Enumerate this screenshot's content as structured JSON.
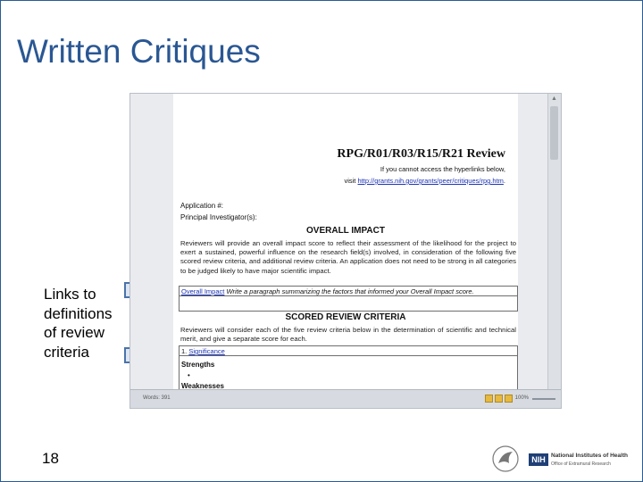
{
  "slide": {
    "title": "Written Critiques",
    "side_text_lines": [
      "Links to",
      "definitions",
      "of review",
      "criteria"
    ],
    "page_number": "18"
  },
  "document": {
    "title": "RPG/R01/R03/R15/R21 Review",
    "hyperlink_note": "If you cannot access the hyperlinks below,",
    "visit_prefix": "visit",
    "url": "http://grants.nih.gov/grants/peer/critiques/rpg.htm",
    "url_suffix": ".",
    "application_label": "Application #:",
    "pi_label": "Principal Investigator(s):",
    "overall_impact_heading": "OVERALL IMPACT",
    "overall_impact_para": "Reviewers will provide an overall impact score to reflect their assessment of the likelihood for the project to exert a sustained, powerful influence on the research field(s) involved, in consideration of the following five scored review criteria, and additional review criteria. An application does not need to be strong in all categories to be judged likely to have major scientific impact.",
    "overall_impact_link": "Overall Impact",
    "overall_impact_instruction": "Write a paragraph summarizing the factors that informed your Overall Impact score.",
    "scored_heading": "SCORED REVIEW CRITERIA",
    "scored_para": "Reviewers will consider each of the five review criteria below in the determination of scientific and technical merit, and give a separate score for each.",
    "significance_number": "1.",
    "significance_link": "Significance",
    "strengths_label": "Strengths",
    "bullet": "•",
    "weaknesses_label": "Weaknesses"
  },
  "word_window": {
    "status_words": "Words: 391",
    "zoom": "100%"
  },
  "colors": {
    "title": "#2a5793",
    "slide_border": "#2b5c93",
    "arrow_fill": "#dbe5f3",
    "arrow_stroke": "#4a72aa",
    "link": "#1c33b5"
  },
  "logo": {
    "nih_abbr": "NIH",
    "nih_name": "National Institutes of Health",
    "nih_sub": "Office of Extramural Research"
  }
}
